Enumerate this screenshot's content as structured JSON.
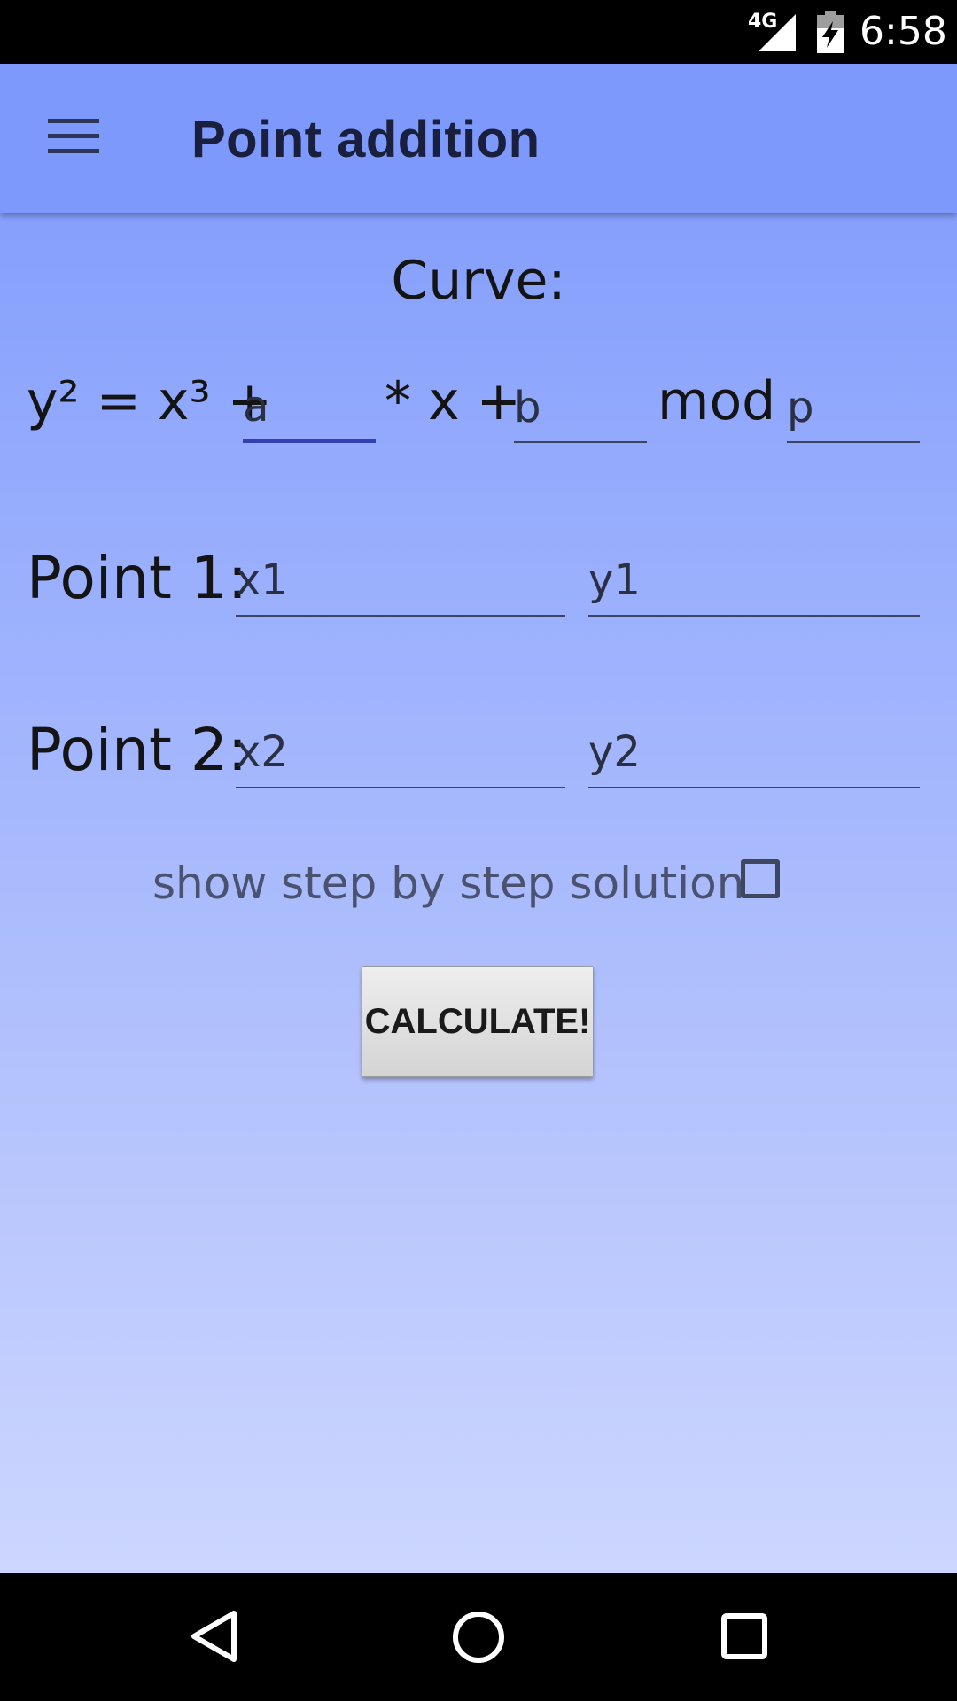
{
  "status_bar": {
    "network": "4G",
    "time": "6:58",
    "icons": [
      "signal-icon",
      "battery-charging-icon"
    ]
  },
  "app_bar": {
    "title": "Point addition",
    "menu_icon": "menu-icon"
  },
  "curve": {
    "heading": "Curve:",
    "equation_start": "y² = x³ +",
    "equation_mid": "* x +",
    "equation_mod": "mod",
    "a_placeholder": "a",
    "b_placeholder": "b",
    "p_placeholder": "p",
    "focused_field": "a"
  },
  "point1": {
    "label": "Point 1:",
    "x_placeholder": "x1",
    "y_placeholder": "y1"
  },
  "point2": {
    "label": "Point 2:",
    "x_placeholder": "x2",
    "y_placeholder": "y2"
  },
  "options": {
    "step_by_step_label": "show step by step solution",
    "step_by_step_checked": false
  },
  "actions": {
    "calculate_label": "CALCULATE!"
  },
  "nav_bar": {
    "icons": [
      "back-icon",
      "home-icon",
      "recents-icon"
    ]
  },
  "colors": {
    "app_bar": "#7d99fc",
    "focus_underline": "#3540b0",
    "gradient_top": "#7d99fc",
    "gradient_bottom": "#ccd6fe"
  }
}
